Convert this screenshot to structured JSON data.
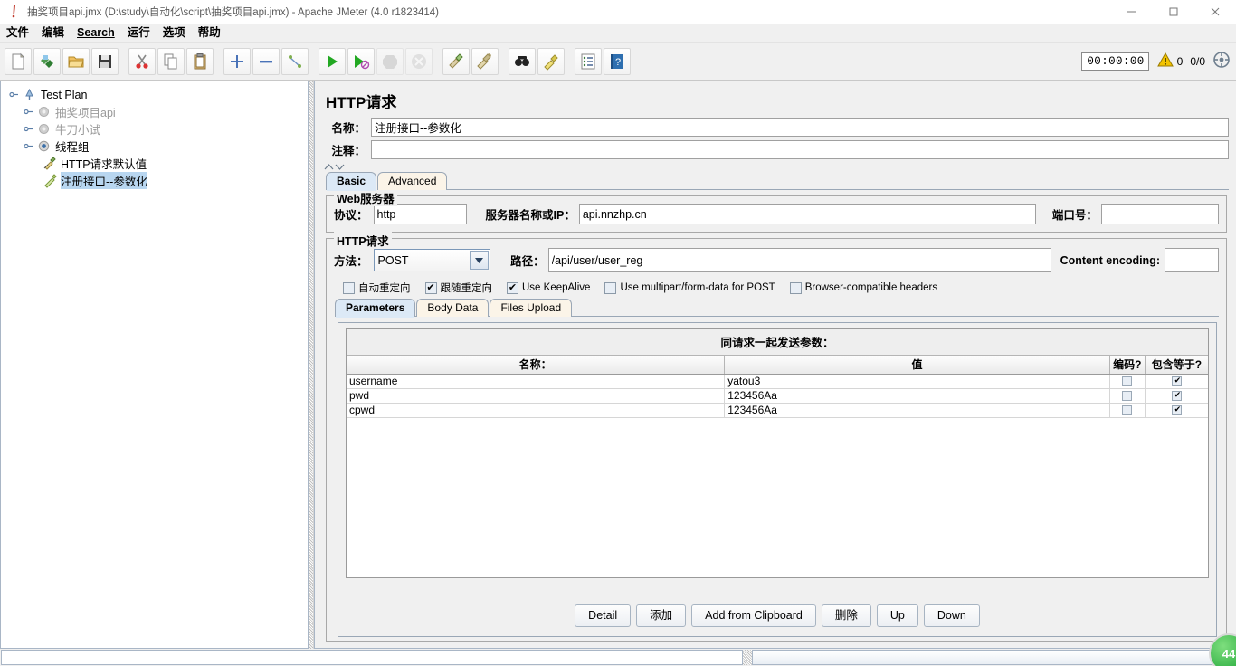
{
  "window": {
    "title": "抽奖项目api.jmx (D:\\study\\自动化\\script\\抽奖项目api.jmx) - Apache JMeter (4.0 r1823414)",
    "minimize_label": "—",
    "maximize_label": "❐",
    "close_label": "✕"
  },
  "menu": {
    "items": [
      {
        "label": "文件",
        "underlined": false
      },
      {
        "label": "编辑",
        "underlined": false
      },
      {
        "label": "Search",
        "underlined": true
      },
      {
        "label": "运行",
        "underlined": false
      },
      {
        "label": "选项",
        "underlined": false
      },
      {
        "label": "帮助",
        "underlined": false
      }
    ]
  },
  "toolbar": {
    "buttons": [
      {
        "name": "new-icon",
        "tip": "New"
      },
      {
        "name": "templates-icon",
        "tip": "Templates"
      },
      {
        "name": "open-icon",
        "tip": "Open"
      },
      {
        "name": "save-icon",
        "tip": "Save"
      },
      {
        "name": "cut-icon",
        "tip": "Cut"
      },
      {
        "name": "copy-icon",
        "tip": "Copy"
      },
      {
        "name": "paste-icon",
        "tip": "Paste"
      },
      {
        "name": "expand-icon",
        "tip": "Expand All"
      },
      {
        "name": "collapse-icon",
        "tip": "Collapse All"
      },
      {
        "name": "toggle-icon",
        "tip": "Toggle"
      },
      {
        "name": "start-icon",
        "tip": "Start"
      },
      {
        "name": "start-no-pauses-icon",
        "tip": "Start no pauses"
      },
      {
        "name": "stop-icon",
        "tip": "Stop"
      },
      {
        "name": "shutdown-icon",
        "tip": "Shutdown"
      },
      {
        "name": "clear-icon",
        "tip": "Clear"
      },
      {
        "name": "clear-all-icon",
        "tip": "Clear All"
      },
      {
        "name": "search-icon",
        "tip": "Search"
      },
      {
        "name": "search-reset-icon",
        "tip": "Reset Search"
      },
      {
        "name": "function-helper-icon",
        "tip": "Function Helper Dialog"
      },
      {
        "name": "help-icon",
        "tip": "Help"
      }
    ],
    "timer": "00:00:00",
    "warning_count": "0",
    "thread_count": "0/0"
  },
  "tree": {
    "nodes": [
      {
        "label": "Test Plan",
        "icon": "test-plan-icon",
        "depth": 0,
        "state": "normal",
        "expander": "expanded"
      },
      {
        "label": "抽奖项目api",
        "icon": "gear-icon",
        "depth": 1,
        "state": "disabled",
        "expander": "collapsed"
      },
      {
        "label": "牛刀小试",
        "icon": "gear-icon",
        "depth": 1,
        "state": "disabled",
        "expander": "collapsed"
      },
      {
        "label": "线程组",
        "icon": "thread-group-icon",
        "depth": 1,
        "state": "normal",
        "expander": "expanded"
      },
      {
        "label": "HTTP请求默认值",
        "icon": "config-icon",
        "depth": 2,
        "state": "normal",
        "expander": "none"
      },
      {
        "label": "注册接口--参数化",
        "icon": "sampler-icon",
        "depth": 2,
        "state": "selected",
        "expander": "none"
      }
    ]
  },
  "panel": {
    "title": "HTTP请求",
    "name_label": "名称：",
    "name_value": "注册接口--参数化",
    "comment_label": "注释：",
    "comment_value": "",
    "tabs": [
      {
        "label": "Basic",
        "active": true
      },
      {
        "label": "Advanced",
        "active": false
      }
    ],
    "webserver": {
      "title": "Web服务器",
      "protocol_label": "协议：",
      "protocol_value": "http",
      "host_label": "服务器名称或IP：",
      "host_value": "api.nnzhp.cn",
      "port_label": "端口号：",
      "port_value": ""
    },
    "httprequest": {
      "title": "HTTP请求",
      "method_label": "方法：",
      "method_value": "POST",
      "path_label": "路径：",
      "path_value": "/api/user/user_reg",
      "content_encoding_label": "Content encoding:",
      "content_encoding_value": "",
      "checkboxes": [
        {
          "label": "自动重定向",
          "checked": false
        },
        {
          "label": "跟随重定向",
          "checked": true
        },
        {
          "label": "Use KeepAlive",
          "checked": true
        },
        {
          "label": "Use multipart/form-data for POST",
          "checked": false
        },
        {
          "label": "Browser-compatible headers",
          "checked": false
        }
      ]
    },
    "param_tabs": [
      {
        "label": "Parameters",
        "active": true
      },
      {
        "label": "Body Data",
        "active": false
      },
      {
        "label": "Files Upload",
        "active": false
      }
    ],
    "params_table": {
      "caption": "同请求一起发送参数：",
      "headers": [
        "名称：",
        "值",
        "编码?",
        "包含等于?"
      ],
      "rows": [
        {
          "name": "username",
          "value": "yatou3",
          "encode": false,
          "include_equals": true
        },
        {
          "name": "pwd",
          "value": "123456Aa",
          "encode": false,
          "include_equals": true
        },
        {
          "name": "cpwd",
          "value": "123456Aa",
          "encode": false,
          "include_equals": true
        }
      ]
    },
    "buttons": [
      {
        "label": "Detail"
      },
      {
        "label": "添加"
      },
      {
        "label": "Add from Clipboard"
      },
      {
        "label": "删除"
      },
      {
        "label": "Up"
      },
      {
        "label": "Down"
      }
    ]
  },
  "overlay": {
    "badge_text": "44"
  }
}
